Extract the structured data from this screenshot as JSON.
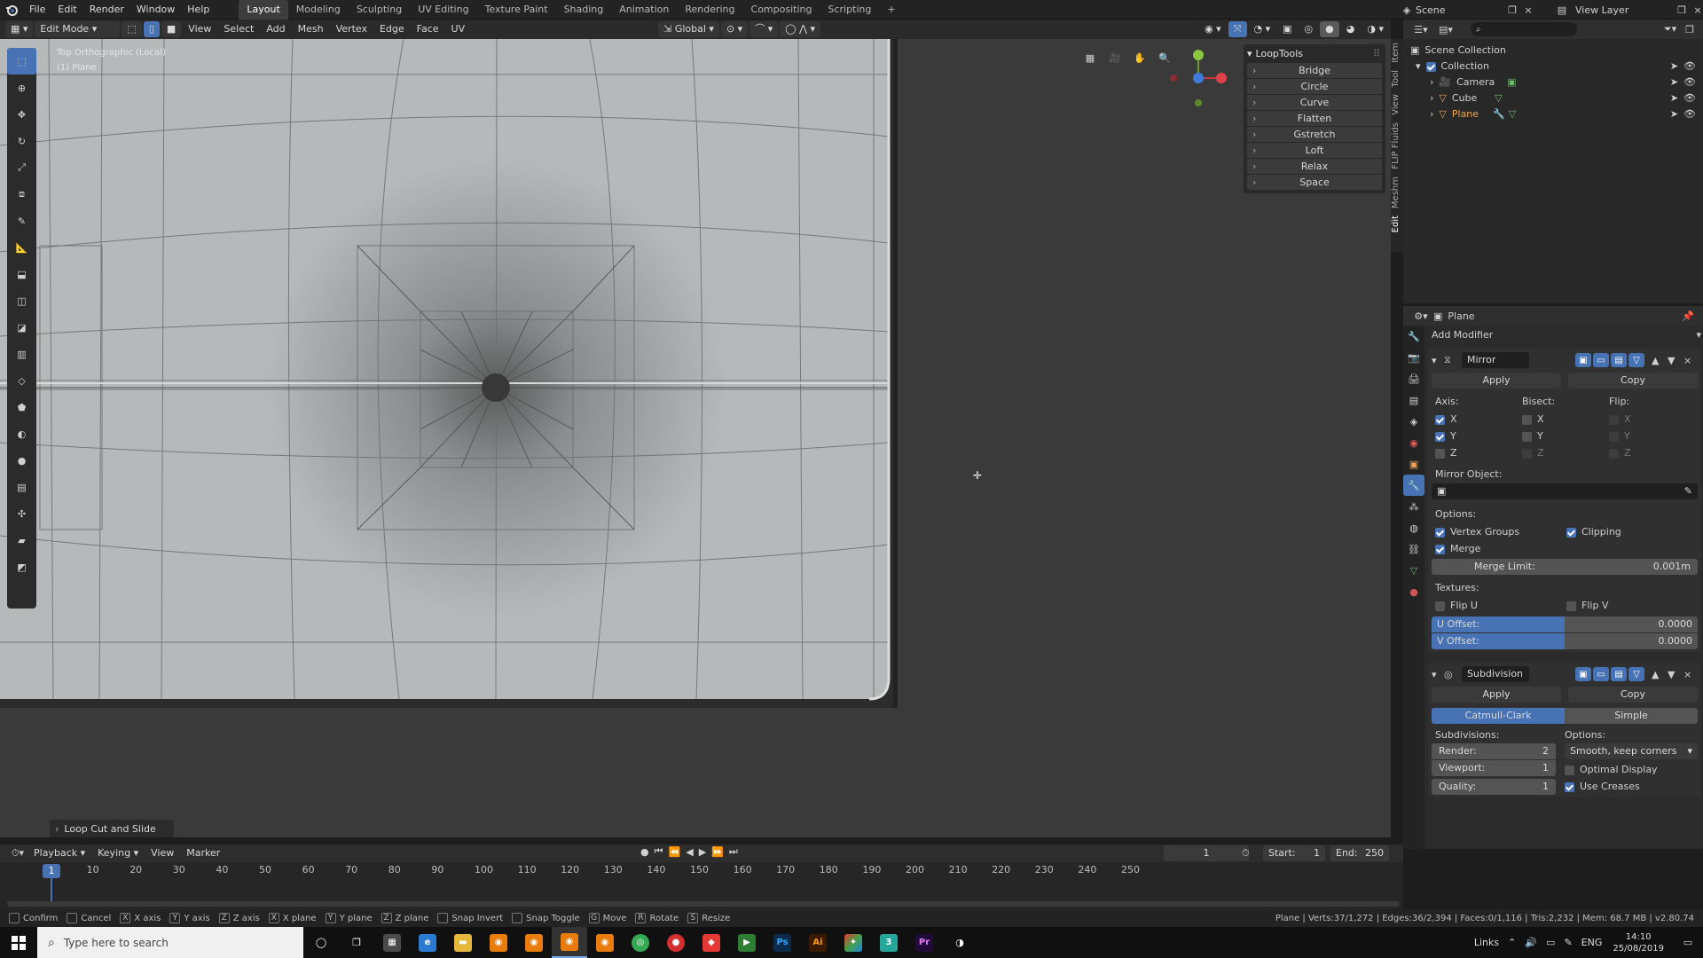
{
  "menu": {
    "items": [
      "File",
      "Edit",
      "Render",
      "Window",
      "Help"
    ]
  },
  "workspaces": [
    "Layout",
    "Modeling",
    "Sculpting",
    "UV Editing",
    "Texture Paint",
    "Shading",
    "Animation",
    "Rendering",
    "Compositing",
    "Scripting"
  ],
  "top_right": {
    "scene": "Scene",
    "view_layer": "View Layer"
  },
  "viewport_header": {
    "mode": "Edit Mode",
    "menus": [
      "View",
      "Select",
      "Add",
      "Mesh",
      "Vertex",
      "Edge",
      "Face",
      "UV"
    ],
    "transform": "Global"
  },
  "viewport": {
    "view_name": "Top Orthographic (Local)",
    "object_name": "(1) Plane",
    "last_op": "Loop Cut and Slide"
  },
  "looptools": {
    "title": "LoopTools",
    "items": [
      "Bridge",
      "Circle",
      "Curve",
      "Flatten",
      "Gstretch",
      "Loft",
      "Relax",
      "Space"
    ]
  },
  "side_tabs": [
    "Item",
    "Tool",
    "View",
    "FLIP Fluids",
    "Meshm",
    "Edit"
  ],
  "outliner": {
    "root": "Scene Collection",
    "collection": "Collection",
    "objects": [
      "Camera",
      "Cube",
      "Plane"
    ]
  },
  "properties": {
    "object": "Plane",
    "add_modifier": "Add Modifier",
    "mirror": {
      "name": "Mirror",
      "apply": "Apply",
      "copy": "Copy",
      "axis_label": "Axis:",
      "bisect_label": "Bisect:",
      "flip_label": "Flip:",
      "axes": [
        "X",
        "Y",
        "Z"
      ],
      "axis_checked": [
        true,
        true,
        false
      ],
      "mirror_object_label": "Mirror Object:",
      "options_label": "Options:",
      "vertex_groups": "Vertex Groups",
      "clipping": "Clipping",
      "merge": "Merge",
      "merge_limit_label": "Merge Limit:",
      "merge_limit": "0.001m",
      "textures_label": "Textures:",
      "flip_u": "Flip U",
      "flip_v": "Flip V",
      "u_offset_label": "U Offset:",
      "u_offset": "0.0000",
      "v_offset_label": "V Offset:",
      "v_offset": "0.0000"
    },
    "subdivision": {
      "name": "Subdivision",
      "apply": "Apply",
      "copy": "Copy",
      "catmull": "Catmull-Clark",
      "simple": "Simple",
      "subdivisions_label": "Subdivisions:",
      "options_label": "Options:",
      "render_label": "Render:",
      "render": "2",
      "viewport_label": "Viewport:",
      "viewport": "1",
      "quality_label": "Quality:",
      "quality": "1",
      "uv_smooth": "Smooth, keep corners",
      "optimal_display": "Optimal Display",
      "use_creases": "Use Creases"
    }
  },
  "timeline": {
    "menus": [
      "Playback",
      "Keying",
      "View",
      "Marker"
    ],
    "current_frame": "1",
    "start_label": "Start:",
    "start": "1",
    "end_label": "End:",
    "end": "250",
    "ticks": [
      "10",
      "20",
      "30",
      "40",
      "50",
      "60",
      "70",
      "80",
      "90",
      "100",
      "110",
      "120",
      "130",
      "140",
      "150",
      "160",
      "170",
      "180",
      "190",
      "200",
      "210",
      "220",
      "230",
      "240",
      "250"
    ],
    "playhead": "1"
  },
  "statusbar": {
    "hints": [
      "Confirm",
      "Cancel",
      "X axis",
      "Y axis",
      "Z axis",
      "X plane",
      "Y plane",
      "Z plane",
      "Snap Invert",
      "Snap Toggle",
      "Move",
      "Rotate",
      "Resize"
    ],
    "keys": [
      "",
      "",
      "X",
      "Y",
      "Z",
      "X",
      "Y",
      "Z",
      "",
      "",
      "G",
      "R",
      "S"
    ],
    "stats": "Plane | Verts:37/1,272 | Edges:36/2,394 | Faces:0/1,116 | Tris:2,232 | Mem: 68.7 MB | v2.80.74"
  },
  "taskbar": {
    "search_placeholder": "Type here to search",
    "links": "Links",
    "lang": "ENG",
    "time": "14:10",
    "date": "25/08/2019"
  }
}
